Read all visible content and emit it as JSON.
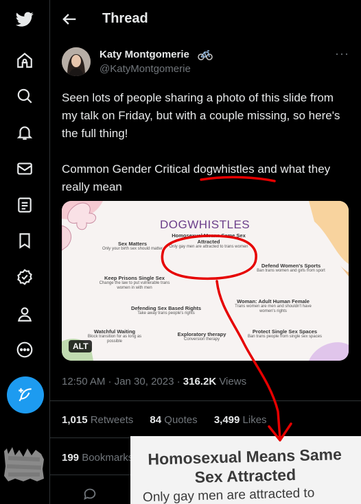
{
  "header": {
    "title": "Thread"
  },
  "nav": [
    "twitter-logo",
    "home-icon",
    "explore-icon",
    "notifications-icon",
    "messages-icon",
    "lists-icon",
    "bookmarks-icon",
    "verified-icon",
    "profile-icon",
    "more-icon"
  ],
  "tweet": {
    "author_name": "Katy Montgomerie",
    "author_emoji": "bicycle",
    "handle": "@KatyMontgomerie",
    "text_p1": "Seen lots of people sharing a photo of this slide from my talk on Friday, but with a couple missing, so here's the full thing!",
    "text_p2_prefix": "Common Gender Critical ",
    "text_p2_highlight": "dogwhistles",
    "text_p2_suffix": " and what they really mean"
  },
  "slide": {
    "title": "DOGWHISTLES",
    "items": [
      {
        "head": "Sex Matters",
        "sub": "Only your birth sex should matter"
      },
      {
        "head": "Homosexual Means Same Sex Attracted",
        "sub": "Only gay men are attracted to trans women"
      },
      {
        "head": "Defend Women's Sports",
        "sub": "Ban trans women and girls from sport"
      },
      {
        "head": "Keep Prisons Single Sex",
        "sub": "Change the law to put vulnerable trans women in with men"
      },
      {
        "head": "Woman: Adult Human Female",
        "sub": "Trans women are men and shouldn't have women's rights"
      },
      {
        "head": "Defending Sex Based Rights",
        "sub": "Take away trans people's rights"
      },
      {
        "head": "Watchful Waiting",
        "sub": "Block transition for as long as possible"
      },
      {
        "head": "Exploratory therapy",
        "sub": "Conversion therapy"
      },
      {
        "head": "Protect Single Sex Spaces",
        "sub": "Ban trans people from single sex spaces"
      }
    ],
    "alt_label": "ALT"
  },
  "meta": {
    "time": "12:50 AM · Jan 30, 2023 · ",
    "views_count": "316.2K",
    "views_label": " Views"
  },
  "stats": {
    "retweets_count": "1,015",
    "retweets_label": " Retweets",
    "quotes_count": "84",
    "quotes_label": " Quotes",
    "likes_count": "3,499",
    "likes_label": " Likes",
    "bookmarks_count": "199",
    "bookmarks_label": " Bookmarks"
  },
  "zoom": {
    "title": "Homosexual Means Same Sex Attracted",
    "sub": "Only gay men are attracted to"
  },
  "colors": {
    "accent": "#1d9bf0",
    "annotation_red": "#e60000",
    "slide_title": "#6b3e8a"
  }
}
